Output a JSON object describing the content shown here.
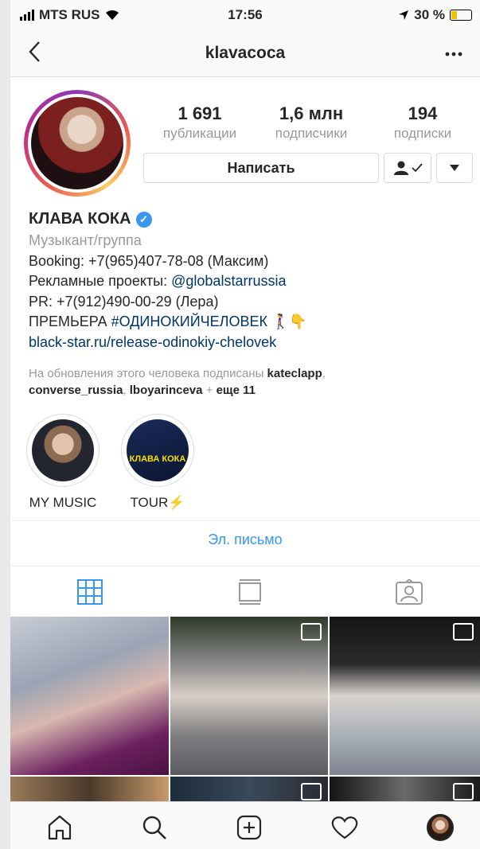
{
  "status_bar": {
    "carrier": "MTS RUS",
    "time": "17:56",
    "battery": "30 %",
    "battery_level": 0.3
  },
  "nav": {
    "username": "klavacoca"
  },
  "stats": [
    {
      "value": "1 691",
      "label": "публикации"
    },
    {
      "value": "1,6 млн",
      "label": "подписчики"
    },
    {
      "value": "194",
      "label": "подписки"
    }
  ],
  "actions": {
    "message": "Написать"
  },
  "bio": {
    "name": "КЛАВА КОКА",
    "category": "Музыкант/группа",
    "line1": "Booking: +7(965)407-78-08 (Максим)",
    "line2_prefix": "Рекламные проекты: ",
    "line2_link": "@globalstarrussia",
    "line3": "PR: +7(912)490-00-29 (Лера)",
    "line4_prefix": "ПРЕМЬЕРА ",
    "line4_tag": "#ОДИНОКИЙЧЕЛОВЕК",
    "line4_emoji": "🚶‍♀️👇",
    "website": "black-star.ru/release-odinokiy-chelovek"
  },
  "followed_by": {
    "prefix": "На обновления этого человека подписаны ",
    "user1": "kateclapp",
    "sep1": ",",
    "user2": "converse_russia",
    "sep2": ", ",
    "user3": "lboyarinceva",
    "sep3": " + ",
    "more": "еще 11"
  },
  "highlights": [
    {
      "label": "MY MUSIC"
    },
    {
      "label": "TOUR",
      "emoji": "⚡",
      "cover_text": "КЛАВА КОКА"
    }
  ],
  "email_button": "Эл. письмо",
  "colors": {
    "accent": "#3897f0",
    "link": "#003569",
    "muted": "#999999",
    "border": "#dbdbdb"
  }
}
